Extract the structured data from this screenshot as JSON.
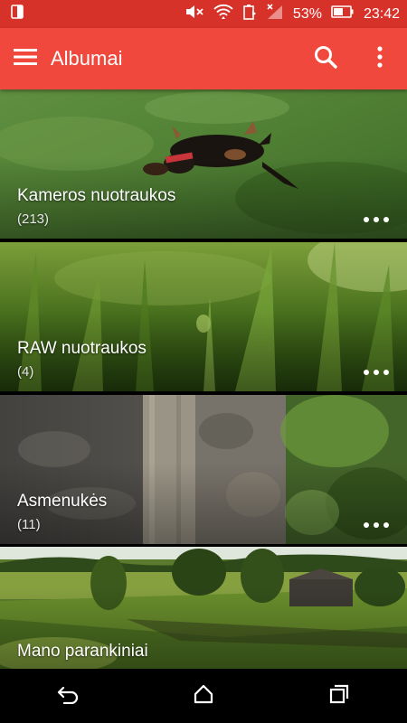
{
  "status_bar": {
    "battery_percent": "53%",
    "time": "23:42",
    "icons": [
      "screen-cast-icon",
      "mute-icon",
      "wifi-icon",
      "battery-saver-icon",
      "signal-icon",
      "battery-icon"
    ]
  },
  "app_bar": {
    "title": "Albumai",
    "icons": [
      "menu-icon",
      "search-icon",
      "overflow-icon"
    ]
  },
  "albums": [
    {
      "name": "Kameros nuotraukos",
      "count": "(213)"
    },
    {
      "name": "RAW nuotraukos",
      "count": "(4)"
    },
    {
      "name": "Asmenukės",
      "count": "(11)"
    },
    {
      "name": "Mano parankiniai",
      "count": ""
    }
  ],
  "nav_bar": {
    "icons": [
      "back-icon",
      "home-icon",
      "recents-icon"
    ]
  },
  "colors": {
    "status_bar": "#d7322a",
    "app_bar": "#f0483c",
    "nav_bar": "#000000"
  }
}
